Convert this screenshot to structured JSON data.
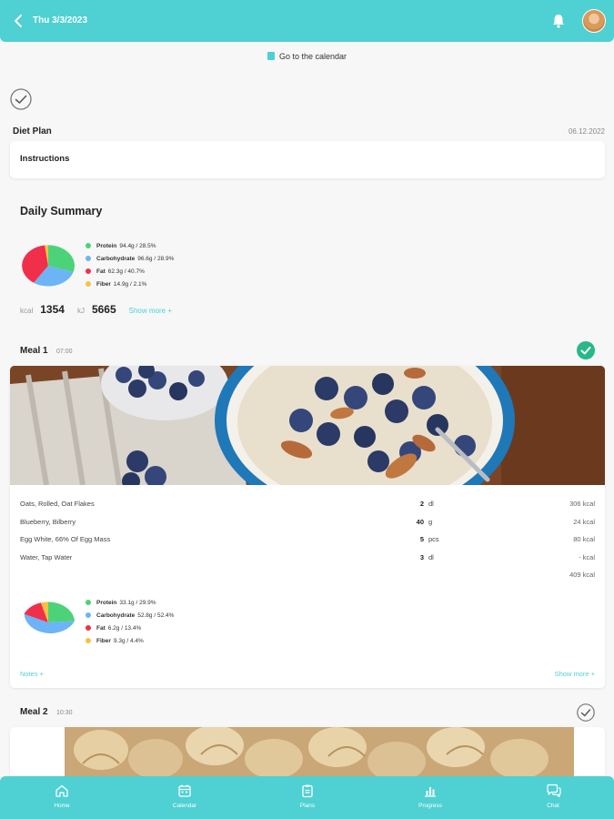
{
  "header": {
    "date": "Thu 3/3/2023",
    "icons": [
      "chevron-left-icon",
      "bell-icon",
      "avatar"
    ]
  },
  "calendar_link": "Go to the calendar",
  "diet_plan": {
    "title": "Diet Plan",
    "date": "06.12.2022",
    "instructions": "Instructions"
  },
  "summary": {
    "title": "Daily Summary",
    "legend": [
      {
        "label": "Protein",
        "value": "94.4g / 28.5%",
        "color": "#4cd37a"
      },
      {
        "label": "Carbohydrate",
        "value": "96.6g / 28.9%",
        "color": "#6cb4f5"
      },
      {
        "label": "Fat",
        "value": "62.3g / 40.7%",
        "color": "#f0304a"
      },
      {
        "label": "Fiber",
        "value": "14.9g / 2.1%",
        "color": "#f7c244"
      }
    ],
    "kcal_unit": "kcal",
    "kcal": "1354",
    "kj_unit": "kJ",
    "kj": "5665",
    "show_more": "Show more +"
  },
  "meals": [
    {
      "title": "Meal 1",
      "time": "07:00",
      "done": true,
      "foods": [
        {
          "name": "Oats, Rolled, Oat Flakes",
          "qty": "2",
          "unit": "dl",
          "kcal": "306 kcal"
        },
        {
          "name": "Blueberry, Bilberry",
          "qty": "40",
          "unit": "g",
          "kcal": "24 kcal"
        },
        {
          "name": "Egg White, 66% Of Egg Mass",
          "qty": "5",
          "unit": "pcs",
          "kcal": "80 kcal"
        },
        {
          "name": "Water, Tap Water",
          "qty": "3",
          "unit": "dl",
          "kcal": "- kcal"
        }
      ],
      "total": "409 kcal",
      "legend": [
        {
          "label": "Protein",
          "value": "33.1g / 29.9%",
          "color": "#4cd37a"
        },
        {
          "label": "Carbohydrate",
          "value": "52.8g / 52.4%",
          "color": "#6cb4f5"
        },
        {
          "label": "Fat",
          "value": "6.2g / 13.4%",
          "color": "#f0304a"
        },
        {
          "label": "Fiber",
          "value": "9.3g / 4.4%",
          "color": "#f7c244"
        }
      ],
      "notes": "Notes +",
      "show_more": "Show more +"
    },
    {
      "title": "Meal 2",
      "time": "10:30",
      "done": false
    }
  ],
  "nav": [
    {
      "label": "Home",
      "icon": "home-icon"
    },
    {
      "label": "Calendar",
      "icon": "calendar-icon"
    },
    {
      "label": "Plans",
      "icon": "clipboard-icon"
    },
    {
      "label": "Progress",
      "icon": "bar-chart-icon"
    },
    {
      "label": "Chat",
      "icon": "chat-icon"
    }
  ]
}
